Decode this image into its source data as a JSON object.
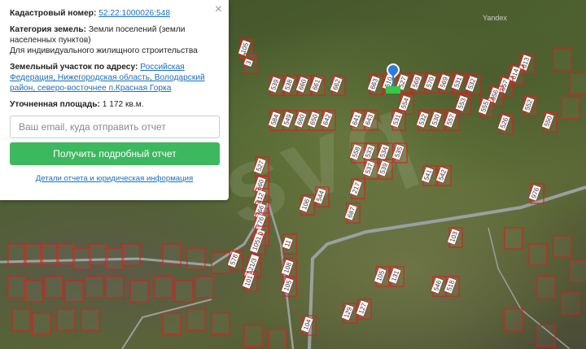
{
  "map": {
    "provider_label": "Yandex",
    "watermark": "svq",
    "parcels": [
      {
        "n": "105"
      },
      {
        "n": "3"
      },
      {
        "n": "539"
      },
      {
        "n": "538"
      },
      {
        "n": "660"
      },
      {
        "n": "661"
      },
      {
        "n": "662"
      },
      {
        "n": "663"
      },
      {
        "n": "510"
      },
      {
        "n": "527"
      },
      {
        "n": "569"
      },
      {
        "n": "570"
      },
      {
        "n": "569"
      },
      {
        "n": "531"
      },
      {
        "n": "532"
      },
      {
        "n": "613"
      },
      {
        "n": "614"
      },
      {
        "n": "557"
      },
      {
        "n": "556"
      },
      {
        "n": "555"
      },
      {
        "n": "554"
      },
      {
        "n": "553"
      },
      {
        "n": "526"
      },
      {
        "n": "550"
      },
      {
        "n": "552"
      },
      {
        "n": "584"
      },
      {
        "n": "549"
      },
      {
        "n": "660"
      },
      {
        "n": "650"
      },
      {
        "n": "642"
      },
      {
        "n": "641"
      },
      {
        "n": "643"
      },
      {
        "n": "531"
      },
      {
        "n": "532"
      },
      {
        "n": "530"
      },
      {
        "n": "557"
      },
      {
        "n": "558"
      },
      {
        "n": "533"
      },
      {
        "n": "534"
      },
      {
        "n": "535"
      },
      {
        "n": "537"
      },
      {
        "n": "539"
      },
      {
        "n": "541"
      },
      {
        "n": "542"
      },
      {
        "n": "527"
      },
      {
        "n": "560"
      },
      {
        "n": "112"
      },
      {
        "n": "766"
      },
      {
        "n": "776"
      },
      {
        "n": "10"
      },
      {
        "n": "1051"
      },
      {
        "n": "11"
      },
      {
        "n": "217"
      },
      {
        "n": "106"
      },
      {
        "n": "544"
      },
      {
        "n": "687"
      },
      {
        "n": "976"
      },
      {
        "n": "578"
      },
      {
        "n": "121/3"
      },
      {
        "n": "101"
      },
      {
        "n": "108"
      },
      {
        "n": "105"
      },
      {
        "n": "104"
      },
      {
        "n": "103"
      },
      {
        "n": "105"
      },
      {
        "n": "131"
      },
      {
        "n": "546"
      },
      {
        "n": "518"
      },
      {
        "n": "129"
      },
      {
        "n": "127"
      },
      {
        "n": "166"
      },
      {
        "n": "165"
      }
    ]
  },
  "card": {
    "close_label": "×",
    "cadastral_label": "Кадастровый номер:",
    "cadastral_value": "52:22:1000026:548",
    "category_label": "Категория земель:",
    "category_value": "Земли поселений (земли населенных пунктов)",
    "usage_value": "Для индивидуального жилищного строительства",
    "address_label": "Земельный участок по адресу:",
    "address_value": "Российская Федерация, Нижегородская область, Володарский район, северо-восточнее п.Красная Горка",
    "area_label": "Уточненная площадь:",
    "area_value": "1 172 кв.м.",
    "email_placeholder": "Ваш email, куда отправить отчет",
    "email_value": "",
    "submit_label": "Получить подробный отчет",
    "details_link": "Детали отчета и юридическая информация"
  },
  "colors": {
    "parcel_border": "#d42020",
    "button": "#3cb85f",
    "link": "#1a6fc1",
    "pin": "#2c7de0"
  }
}
